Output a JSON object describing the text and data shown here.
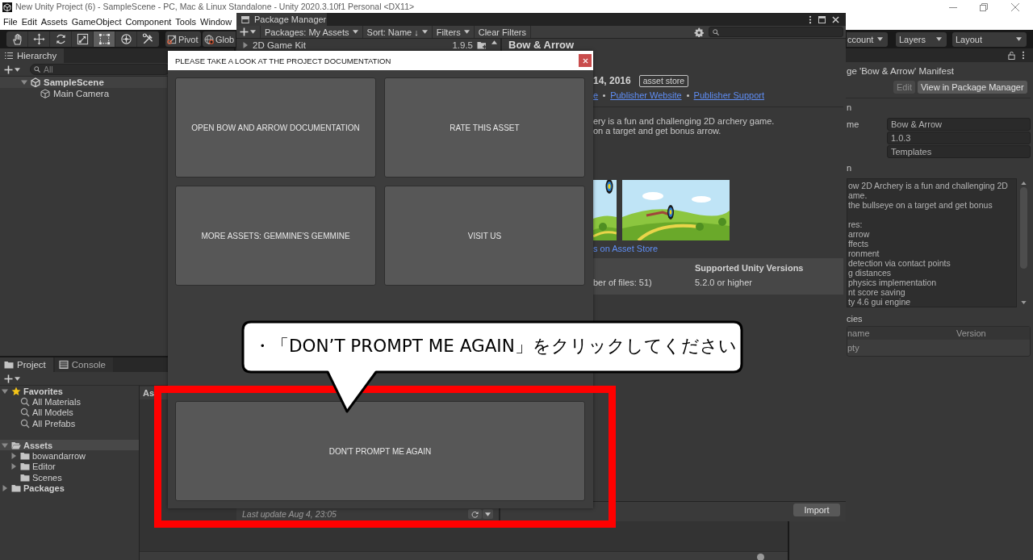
{
  "window": {
    "title": "New Unity Project (6) - SampleScene - PC, Mac & Linux Standalone - Unity 2020.3.10f1 Personal <DX11>"
  },
  "menu": [
    "File",
    "Edit",
    "Assets",
    "GameObject",
    "Component",
    "Tools",
    "Window"
  ],
  "toolbar": {
    "tools": [
      {
        "kind": "hand",
        "selected": false
      },
      {
        "kind": "move",
        "selected": false
      },
      {
        "kind": "rotate",
        "selected": false
      },
      {
        "kind": "scale",
        "selected": false
      },
      {
        "kind": "rect",
        "selected": true
      },
      {
        "kind": "transform",
        "selected": false
      },
      {
        "kind": "custom",
        "selected": false
      }
    ],
    "pivot": "Pivot",
    "handle_space": "Glob",
    "account": "ccount",
    "layers": "Layers",
    "layout": "Layout"
  },
  "hierarchy": {
    "tab": {
      "label": "Hierarchy",
      "selected": true
    },
    "search": {
      "placeholder": "All"
    },
    "items": [
      {
        "label": "SampleScene",
        "kind": "scene",
        "expanded": true,
        "children": [
          {
            "label": "Main Camera",
            "kind": "object"
          }
        ]
      }
    ]
  },
  "project": {
    "tabs": [
      {
        "label": "Project",
        "kind": "project",
        "selected": true
      },
      {
        "label": "Console",
        "kind": "console",
        "selected": false
      }
    ],
    "tree": [
      {
        "label": "Favorites",
        "kind": "favorites",
        "expanded": true,
        "selected": false,
        "children": [
          {
            "label": "All Materials",
            "kind": "search",
            "selected": false
          },
          {
            "label": "All Models",
            "kind": "search",
            "selected": false
          },
          {
            "label": "All Prefabs",
            "kind": "search",
            "selected": false
          }
        ]
      },
      {
        "label": "Assets",
        "kind": "folder",
        "expanded": true,
        "selected": true,
        "children": [
          {
            "label": "bowandarrow",
            "kind": "folder",
            "expanded": false,
            "selected": false
          },
          {
            "label": "Editor",
            "kind": "folder",
            "expanded": false,
            "selected": false
          },
          {
            "label": "Scenes",
            "kind": "folder",
            "selected": false
          }
        ]
      },
      {
        "label": "Packages",
        "kind": "folder",
        "expanded": false,
        "selected": false
      }
    ],
    "breadcrumb": "As"
  },
  "inspector": {
    "header": "ge 'Bow & Arrow' Manifest",
    "buttons": [
      {
        "label": "Edit",
        "disabled": true
      },
      {
        "label": "View in Package Manager",
        "disabled": false
      }
    ],
    "info_label": "n",
    "fields": [
      {
        "label": "me",
        "value": "Bow & Arrow"
      },
      {
        "value": "1.0.3"
      },
      {
        "value": "Templates"
      }
    ],
    "description_label": "n",
    "description": "ow 2D Archery is a fun and challenging 2D\name.\nthe bullseye on a target and get bonus\n\nres:\narrow\nffects\nronment\ndetection via contact points\ng distances\nphysics implementation\nnt score saving\nty 4.6 gui engine",
    "dependencies_label": "cies",
    "dependencies": {
      "columns": [
        "name",
        "Version"
      ],
      "rows": [
        [
          "pty"
        ]
      ]
    }
  },
  "package_manager": {
    "title": "Package Manager",
    "toolbar": {
      "packages": "Packages: My Assets",
      "sort": "Sort: Name ↓",
      "filters": "Filters",
      "clear": "Clear Filters"
    },
    "list": [
      {
        "name": "2D Game Kit",
        "version": "1.9.5",
        "expanded": false
      }
    ],
    "detail": {
      "title": "Bow & Arrow",
      "date": "14, 2016",
      "badge": "asset store",
      "links": [
        "e",
        "Publisher Website",
        "Publisher Support"
      ],
      "description": [
        "ery is a fun and challenging 2D archery game.",
        "on a target and get bonus arrow."
      ],
      "store_link": "s on Asset Store",
      "info": [
        {
          "value": "ber of files: 51)"
        },
        {
          "header": "Supported Unity Versions",
          "value": "5.2.0 or higher"
        }
      ]
    },
    "footer": {
      "last_update": "Last update Aug 4, 23:05",
      "import": "Import"
    }
  },
  "dialog": {
    "title": "PLEASE TAKE A LOOK AT THE PROJECT DOCUMENTATION",
    "buttons": [
      "OPEN BOW AND ARROW DOCUMENTATION",
      "RATE THIS ASSET",
      "MORE ASSETS: GEMMINE'S GEMMINE",
      "VISIT US"
    ],
    "dismiss": "DON'T PROMPT ME AGAIN"
  },
  "callout": {
    "text": "・「DON’T PROMPT ME AGAIN」をクリックしてください"
  }
}
